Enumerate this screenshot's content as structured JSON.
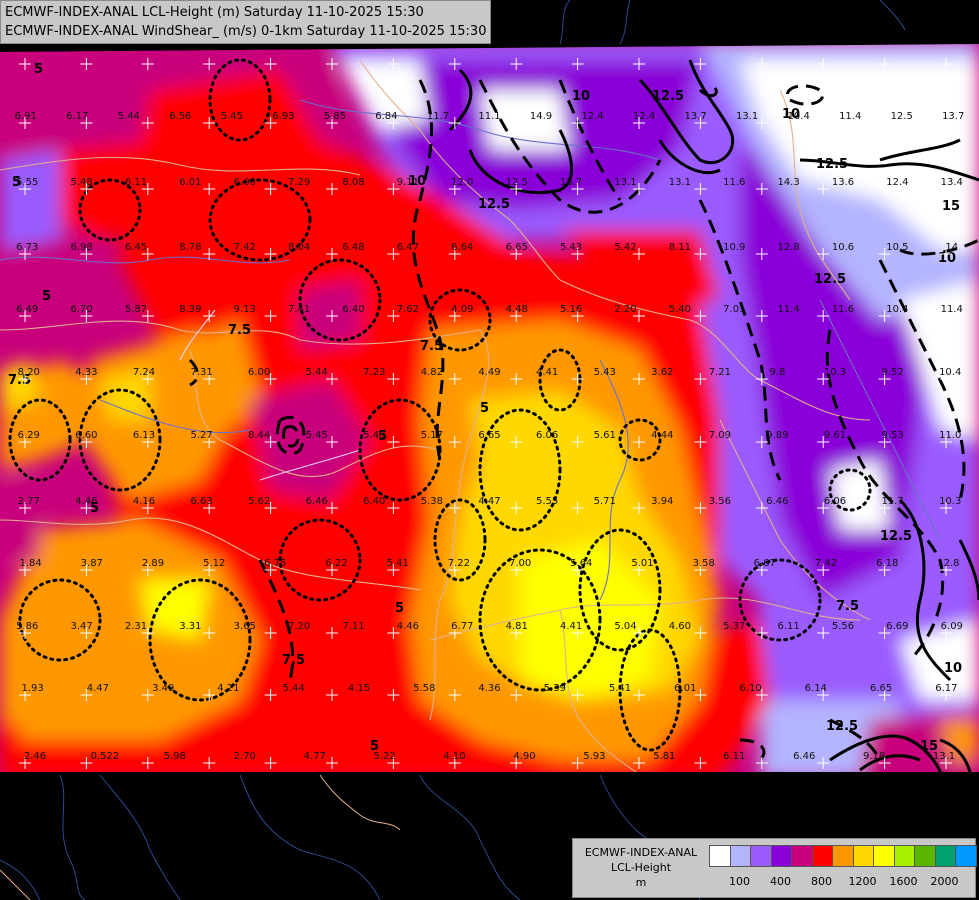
{
  "titles": {
    "line1": "ECMWF-INDEX-ANAL LCL-Height (m) Saturday 11-10-2025 15:30",
    "line2": "ECMWF-INDEX-ANAL WindShear_ (m/s) 0-1km Saturday 11-10-2025 15:30"
  },
  "legend": {
    "title_line1": "ECMWF-INDEX-ANAL",
    "title_line2": "LCL-Height",
    "title_line3": "m",
    "colors": [
      "#ffffff",
      "#b4b4ff",
      "#9a5cff",
      "#8a00d8",
      "#c8007c",
      "#ff0000",
      "#ff9800",
      "#ffd800",
      "#ffff00",
      "#a8f000",
      "#5ab400",
      "#00a070",
      "#0098ff"
    ],
    "ticks": [
      "100",
      "400",
      "800",
      "1200",
      "1600",
      "2000"
    ]
  },
  "contour_labels": [
    "5",
    "7.5",
    "10",
    "12.5",
    "15"
  ],
  "values": [
    "6.91",
    "6.17",
    "5.44",
    "6.56",
    "5.45",
    "6.93",
    "5.85",
    "6.84",
    "11.7",
    "11.1",
    "14.9",
    "12.4",
    "12.4",
    "13.7",
    "13.1",
    "10.4",
    "11.4",
    "12.5",
    "13.7",
    "5.55",
    "5.48",
    "6.11",
    "6.01",
    "6.00",
    "7.29",
    "8.08",
    "9.11",
    "12.0",
    "12.5",
    "13.7",
    "13.1",
    "13.1",
    "11.6",
    "14.3",
    "13.6",
    "12.4",
    "13.4",
    "6.73",
    "6.98",
    "6.45",
    "8.78",
    "7.42",
    "8.04",
    "6.48",
    "6.47",
    "6.64",
    "6.65",
    "5.43",
    "5.42",
    "8.11",
    "10.9",
    "12.8",
    "10.6",
    "10.5",
    "14",
    "6.49",
    "6.70",
    "5.87",
    "8.39",
    "9.13",
    "7.41",
    "6.40",
    "7.62",
    "4.09",
    "4.48",
    "5.16",
    "2.20",
    "5.40",
    "7.01",
    "11.4",
    "11.6",
    "10.4",
    "11.4",
    "8.20",
    "4.33",
    "7.24",
    "7.31",
    "6.00",
    "5.44",
    "7.23",
    "4.82",
    "4.49",
    "4.41",
    "5.43",
    "3.62",
    "7.21",
    "9.8",
    "10.3",
    "9.52",
    "10.4",
    "6.29",
    "6.60",
    "6.13",
    "5.27",
    "8.44",
    "5.45",
    "5.48",
    "5.17",
    "6.65",
    "6.06",
    "5.61",
    "4.44",
    "7.09",
    "9.89",
    "9.61",
    "9.53",
    "11.0",
    "2.77",
    "4.46",
    "4.16",
    "6.63",
    "5.62",
    "6.46",
    "6.40",
    "5.38",
    "4.47",
    "5.55",
    "5.71",
    "3.94",
    "3.56",
    "6.46",
    "6.06",
    "11.7",
    "10.3",
    "1.84",
    "3.87",
    "2.89",
    "5.12",
    "6.75",
    "6.22",
    "5.41",
    "7.22",
    "7.00",
    "5.64",
    "5.01",
    "3.58",
    "6.67",
    "7.42",
    "6.18",
    "12.8",
    "5.86",
    "3.47",
    "2.31",
    "3.31",
    "3.65",
    "7.20",
    "7.11",
    "4.46",
    "6.77",
    "4.81",
    "4.41",
    "5.04",
    "4.60",
    "5.37",
    "6.11",
    "5.56",
    "6.69",
    "6.09",
    "1.93",
    "4.47",
    "3.49",
    "4.21",
    "5.44",
    "4.15",
    "5.58",
    "4.36",
    "5.39",
    "5.41",
    "6.01",
    "6.10",
    "6.14",
    "6.65",
    "6.17",
    "2.46",
    "0.522",
    "5.98",
    "2.70",
    "4.77",
    "5.22",
    "4.10",
    "4.90",
    "5.93",
    "5.81",
    "6.11",
    "6.46",
    "9.18",
    "13.1"
  ]
}
